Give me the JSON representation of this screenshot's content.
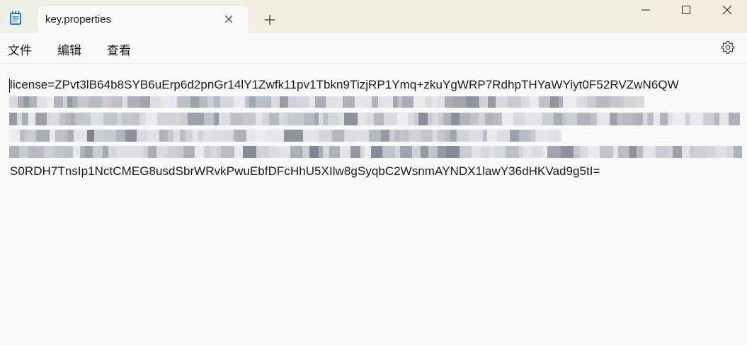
{
  "window": {
    "tab_title": "key.properties",
    "accent": "#1f6fc9"
  },
  "menu": {
    "file": "文件",
    "edit": "编辑",
    "view": "查看"
  },
  "icons": {
    "app": "notepad-icon",
    "tab_close": "close-icon",
    "new_tab": "plus-icon",
    "minimize": "minimize-icon",
    "maximize": "maximize-icon",
    "close": "close-icon",
    "settings": "gear-icon"
  },
  "editor": {
    "line_first": "license=ZPvt3lB64b8SYB6uErp6d2pnGr14lY1Zwfk11pv1Tbkn9TizjRP1Ymq+zkuYgWRP7RdhpTHYaWYiyt0F52RVZwN6QW",
    "line_last": "S0RDH7TnsIp1NctCMEG8usdSbrWRvkPwuEbfDFcHhU5XIlw8gSyqbC2WsnmAYNDX1lawY36dHKVad9g5tI="
  }
}
